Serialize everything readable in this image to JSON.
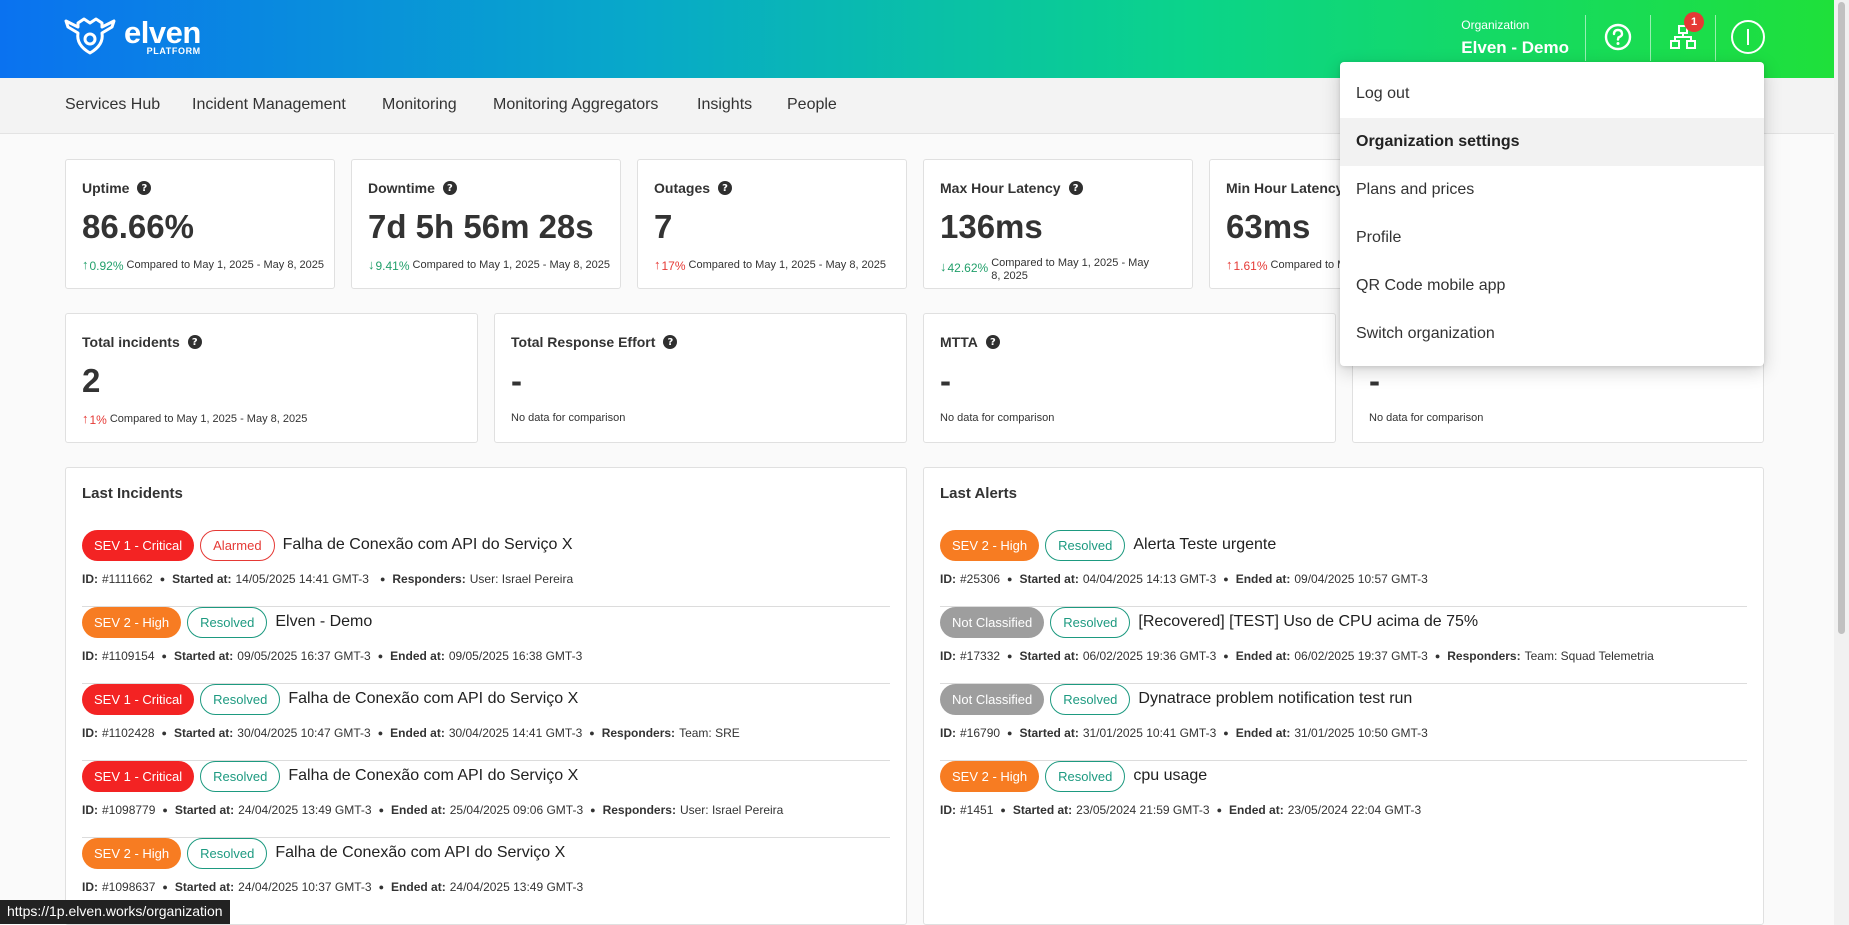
{
  "app": {
    "logo_word": "elven",
    "logo_sub": "PLATFORM"
  },
  "header": {
    "org_label": "Organization",
    "org_name": "Elven - Demo",
    "notification_count": "1"
  },
  "nav": {
    "items": [
      "Services Hub",
      "Incident Management",
      "Monitoring",
      "Monitoring Aggregators",
      "Insights",
      "People"
    ]
  },
  "metrics": {
    "uptime": {
      "title": "Uptime",
      "value": "86.66%",
      "direction": "up",
      "pct": "0.92%",
      "compare": "Compared to May 1, 2025 - May 8, 2025"
    },
    "downtime": {
      "title": "Downtime",
      "value": "7d 5h 56m 28s",
      "direction": "down",
      "pct": "9.41%",
      "compare": "Compared to May 1, 2025 - May 8, 2025"
    },
    "outages": {
      "title": "Outages",
      "value": "7",
      "direction": "up",
      "pct": "17%",
      "compare": "Compared to May 1, 2025 - May 8, 2025"
    },
    "max_latency": {
      "title": "Max Hour Latency",
      "value": "136ms",
      "direction": "down",
      "pct": "42.62%",
      "compare": "Compared to May 1, 2025 - May 8, 2025"
    },
    "min_latency": {
      "title": "Min Hour Latency",
      "value": "63ms",
      "direction": "up",
      "pct": "1.61%",
      "compare": "Compared to M"
    }
  },
  "incident_metrics": {
    "total_incidents": {
      "title": "Total incidents",
      "value": "2",
      "direction": "up",
      "pct": "1%",
      "compare": "Compared to May 1, 2025 - May 8, 2025"
    },
    "response_effort": {
      "title": "Total Response Effort",
      "value": "-",
      "compare": "No data for comparison"
    },
    "mtta": {
      "title": "MTTA",
      "value": "-",
      "compare": "No data for comparison"
    },
    "fourth": {
      "value": "-",
      "compare": "No data for comparison"
    }
  },
  "labels": {
    "id": "ID:",
    "started_at": "Started at:",
    "ended_at": "Ended at:",
    "responders": "Responders:"
  },
  "last_incidents": {
    "title": "Last Incidents",
    "rows": [
      {
        "sev": "SEV 1 - Critical",
        "status": "Alarmed",
        "title": "Falha de Conexão com API do Serviço X",
        "id": "#1111662",
        "started": "14/05/2025 14:41 GMT-3",
        "ended": "",
        "responders_kind": "User:",
        "responders": "Israel Pereira"
      },
      {
        "sev": "SEV 2 - High",
        "status": "Resolved",
        "title": "Elven - Demo",
        "id": "#1109154",
        "started": "09/05/2025 16:37 GMT-3",
        "ended": "09/05/2025 16:38 GMT-3",
        "responders_kind": "",
        "responders": ""
      },
      {
        "sev": "SEV 1 - Critical",
        "status": "Resolved",
        "title": "Falha de Conexão com API do Serviço X",
        "id": "#1102428",
        "started": "30/04/2025 10:47 GMT-3",
        "ended": "30/04/2025 14:41 GMT-3",
        "responders_kind": "Team:",
        "responders": "SRE"
      },
      {
        "sev": "SEV 1 - Critical",
        "status": "Resolved",
        "title": "Falha de Conexão com API do Serviço X",
        "id": "#1098779",
        "started": "24/04/2025 13:49 GMT-3",
        "ended": "25/04/2025 09:06 GMT-3",
        "responders_kind": "User:",
        "responders": "Israel Pereira"
      },
      {
        "sev": "SEV 2 - High",
        "status": "Resolved",
        "title": "Falha de Conexão com API do Serviço X",
        "id": "#1098637",
        "started": "24/04/2025 10:37 GMT-3",
        "ended": "24/04/2025 13:49 GMT-3",
        "responders_kind": "",
        "responders": ""
      }
    ]
  },
  "last_alerts": {
    "title": "Last Alerts",
    "rows": [
      {
        "sev": "SEV 2 - High",
        "status": "Resolved",
        "title": "Alerta Teste urgente",
        "id": "#25306",
        "started": "04/04/2025 14:13 GMT-3",
        "ended": "09/04/2025 10:57 GMT-3",
        "responders_kind": "",
        "responders": ""
      },
      {
        "sev": "Not Classified",
        "status": "Resolved",
        "title": "[Recovered] [TEST] Uso de CPU acima de 75%",
        "id": "#17332",
        "started": "06/02/2025 19:36 GMT-3",
        "ended": "06/02/2025 19:37 GMT-3",
        "responders_kind": "Team:",
        "responders": "Squad Telemetria"
      },
      {
        "sev": "Not Classified",
        "status": "Resolved",
        "title": "Dynatrace problem notification test run",
        "id": "#16790",
        "started": "31/01/2025 10:41 GMT-3",
        "ended": "31/01/2025 10:50 GMT-3",
        "responders_kind": "",
        "responders": ""
      },
      {
        "sev": "SEV 2 - High",
        "status": "Resolved",
        "title": "cpu usage",
        "id": "#1451",
        "started": "23/05/2024 21:59 GMT-3",
        "ended": "23/05/2024 22:04 GMT-3",
        "responders_kind": "",
        "responders": ""
      }
    ]
  },
  "user_menu": {
    "items": [
      "Log out",
      "Organization settings",
      "Plans and prices",
      "Profile",
      "QR Code mobile app",
      "Switch organization"
    ],
    "active_index": 1
  },
  "status_bar": {
    "url": "https://1p.elven.works/organization"
  },
  "colors": {
    "critical": "#f32323",
    "high": "#f77c22",
    "not_classified": "#9e9e9e",
    "resolved": "#1d9a80",
    "alarmed": "#e53935",
    "trend_good": "#22a06b",
    "trend_bad": "#e53935"
  },
  "icons": {
    "help": "question-circle-icon",
    "org": "org-structure-icon",
    "user": "avatar-icon"
  }
}
